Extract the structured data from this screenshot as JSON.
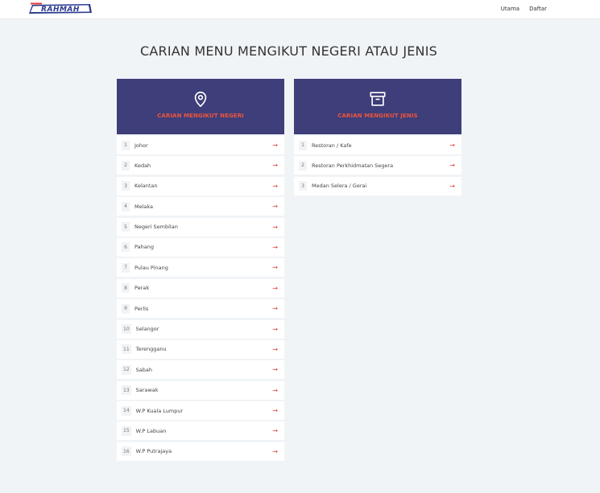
{
  "header": {
    "logo_text": "RAHMAH",
    "nav": [
      {
        "label": "Utama"
      },
      {
        "label": "Daftar"
      }
    ]
  },
  "page": {
    "title": "CARIAN MENU MENGIKUT NEGERI ATAU JENIS"
  },
  "state_card": {
    "icon": "map-pin-icon",
    "label": "CARIAN MENGIKUT NEGERI",
    "items": [
      {
        "num": "1",
        "name": "Johor"
      },
      {
        "num": "2",
        "name": "Kedah"
      },
      {
        "num": "3",
        "name": "Kelantan"
      },
      {
        "num": "4",
        "name": "Melaka"
      },
      {
        "num": "5",
        "name": "Negeri Sembilan"
      },
      {
        "num": "6",
        "name": "Pahang"
      },
      {
        "num": "7",
        "name": "Pulau Pinang"
      },
      {
        "num": "8",
        "name": "Perak"
      },
      {
        "num": "9",
        "name": "Perlis"
      },
      {
        "num": "10",
        "name": "Selangor"
      },
      {
        "num": "11",
        "name": "Terengganu"
      },
      {
        "num": "12",
        "name": "Sabah"
      },
      {
        "num": "13",
        "name": "Sarawak"
      },
      {
        "num": "14",
        "name": "W.P Kuala Lumpur"
      },
      {
        "num": "15",
        "name": "W.P Labuan"
      },
      {
        "num": "16",
        "name": "W.P Putrajaya"
      }
    ]
  },
  "type_card": {
    "icon": "archive-box-icon",
    "label": "CARIAN MENGIKUT JENIS",
    "items": [
      {
        "num": "1",
        "name": "Restoran / Kafe"
      },
      {
        "num": "2",
        "name": "Restoran Perkhidmatan Segera"
      },
      {
        "num": "3",
        "name": "Medan Selera / Gerai"
      }
    ]
  },
  "arrow_glyph": "→",
  "colors": {
    "card_header": "#3e3e7a",
    "accent": "#f0543a",
    "arrow": "#e8383a",
    "background": "#f1f4f7"
  }
}
